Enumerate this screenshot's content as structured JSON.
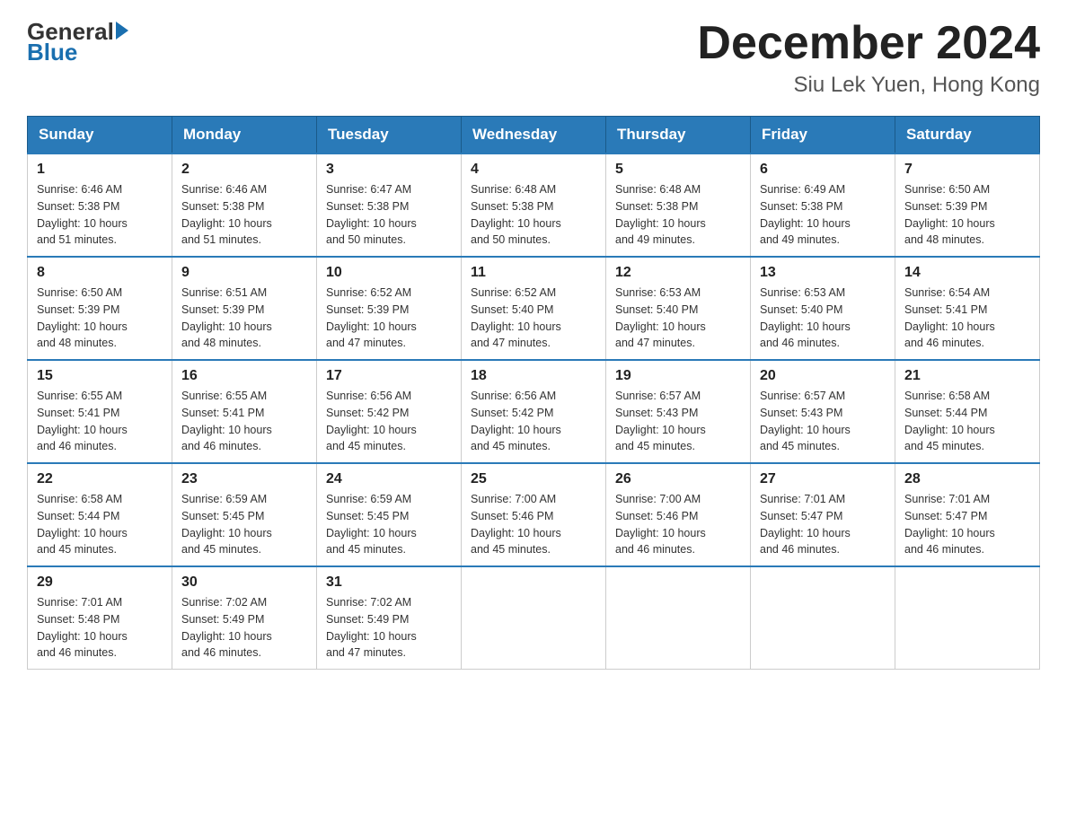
{
  "header": {
    "logo_general": "General",
    "logo_blue": "Blue",
    "month_title": "December 2024",
    "subtitle": "Siu Lek Yuen, Hong Kong"
  },
  "days_of_week": [
    "Sunday",
    "Monday",
    "Tuesday",
    "Wednesday",
    "Thursday",
    "Friday",
    "Saturday"
  ],
  "weeks": [
    [
      {
        "day": "1",
        "sunrise": "6:46 AM",
        "sunset": "5:38 PM",
        "daylight": "10 hours and 51 minutes."
      },
      {
        "day": "2",
        "sunrise": "6:46 AM",
        "sunset": "5:38 PM",
        "daylight": "10 hours and 51 minutes."
      },
      {
        "day": "3",
        "sunrise": "6:47 AM",
        "sunset": "5:38 PM",
        "daylight": "10 hours and 50 minutes."
      },
      {
        "day": "4",
        "sunrise": "6:48 AM",
        "sunset": "5:38 PM",
        "daylight": "10 hours and 50 minutes."
      },
      {
        "day": "5",
        "sunrise": "6:48 AM",
        "sunset": "5:38 PM",
        "daylight": "10 hours and 49 minutes."
      },
      {
        "day": "6",
        "sunrise": "6:49 AM",
        "sunset": "5:38 PM",
        "daylight": "10 hours and 49 minutes."
      },
      {
        "day": "7",
        "sunrise": "6:50 AM",
        "sunset": "5:39 PM",
        "daylight": "10 hours and 48 minutes."
      }
    ],
    [
      {
        "day": "8",
        "sunrise": "6:50 AM",
        "sunset": "5:39 PM",
        "daylight": "10 hours and 48 minutes."
      },
      {
        "day": "9",
        "sunrise": "6:51 AM",
        "sunset": "5:39 PM",
        "daylight": "10 hours and 48 minutes."
      },
      {
        "day": "10",
        "sunrise": "6:52 AM",
        "sunset": "5:39 PM",
        "daylight": "10 hours and 47 minutes."
      },
      {
        "day": "11",
        "sunrise": "6:52 AM",
        "sunset": "5:40 PM",
        "daylight": "10 hours and 47 minutes."
      },
      {
        "day": "12",
        "sunrise": "6:53 AM",
        "sunset": "5:40 PM",
        "daylight": "10 hours and 47 minutes."
      },
      {
        "day": "13",
        "sunrise": "6:53 AM",
        "sunset": "5:40 PM",
        "daylight": "10 hours and 46 minutes."
      },
      {
        "day": "14",
        "sunrise": "6:54 AM",
        "sunset": "5:41 PM",
        "daylight": "10 hours and 46 minutes."
      }
    ],
    [
      {
        "day": "15",
        "sunrise": "6:55 AM",
        "sunset": "5:41 PM",
        "daylight": "10 hours and 46 minutes."
      },
      {
        "day": "16",
        "sunrise": "6:55 AM",
        "sunset": "5:41 PM",
        "daylight": "10 hours and 46 minutes."
      },
      {
        "day": "17",
        "sunrise": "6:56 AM",
        "sunset": "5:42 PM",
        "daylight": "10 hours and 45 minutes."
      },
      {
        "day": "18",
        "sunrise": "6:56 AM",
        "sunset": "5:42 PM",
        "daylight": "10 hours and 45 minutes."
      },
      {
        "day": "19",
        "sunrise": "6:57 AM",
        "sunset": "5:43 PM",
        "daylight": "10 hours and 45 minutes."
      },
      {
        "day": "20",
        "sunrise": "6:57 AM",
        "sunset": "5:43 PM",
        "daylight": "10 hours and 45 minutes."
      },
      {
        "day": "21",
        "sunrise": "6:58 AM",
        "sunset": "5:44 PM",
        "daylight": "10 hours and 45 minutes."
      }
    ],
    [
      {
        "day": "22",
        "sunrise": "6:58 AM",
        "sunset": "5:44 PM",
        "daylight": "10 hours and 45 minutes."
      },
      {
        "day": "23",
        "sunrise": "6:59 AM",
        "sunset": "5:45 PM",
        "daylight": "10 hours and 45 minutes."
      },
      {
        "day": "24",
        "sunrise": "6:59 AM",
        "sunset": "5:45 PM",
        "daylight": "10 hours and 45 minutes."
      },
      {
        "day": "25",
        "sunrise": "7:00 AM",
        "sunset": "5:46 PM",
        "daylight": "10 hours and 45 minutes."
      },
      {
        "day": "26",
        "sunrise": "7:00 AM",
        "sunset": "5:46 PM",
        "daylight": "10 hours and 46 minutes."
      },
      {
        "day": "27",
        "sunrise": "7:01 AM",
        "sunset": "5:47 PM",
        "daylight": "10 hours and 46 minutes."
      },
      {
        "day": "28",
        "sunrise": "7:01 AM",
        "sunset": "5:47 PM",
        "daylight": "10 hours and 46 minutes."
      }
    ],
    [
      {
        "day": "29",
        "sunrise": "7:01 AM",
        "sunset": "5:48 PM",
        "daylight": "10 hours and 46 minutes."
      },
      {
        "day": "30",
        "sunrise": "7:02 AM",
        "sunset": "5:49 PM",
        "daylight": "10 hours and 46 minutes."
      },
      {
        "day": "31",
        "sunrise": "7:02 AM",
        "sunset": "5:49 PM",
        "daylight": "10 hours and 47 minutes."
      },
      null,
      null,
      null,
      null
    ]
  ],
  "labels": {
    "sunrise": "Sunrise:",
    "sunset": "Sunset:",
    "daylight": "Daylight:"
  }
}
